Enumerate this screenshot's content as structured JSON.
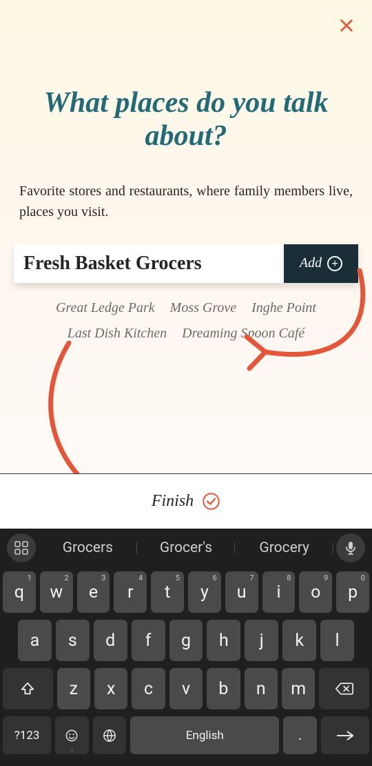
{
  "heading": "What places do you talk about?",
  "subheading": "Favorite stores and restaurants, where family members live, places you visit.",
  "input": {
    "value": "Fresh Basket Grocers"
  },
  "add_label": "Add",
  "suggestions": [
    "Great Ledge Park",
    "Moss Grove",
    "Inghe Point",
    "Last Dish Kitchen",
    "Dreaming Spoon Café"
  ],
  "finish_label": "Finish",
  "keyboard": {
    "suggestions": [
      "Grocers",
      "Grocer's",
      "Grocery"
    ],
    "row1": [
      {
        "k": "q",
        "h": "1"
      },
      {
        "k": "w",
        "h": "2"
      },
      {
        "k": "e",
        "h": "3"
      },
      {
        "k": "r",
        "h": "4"
      },
      {
        "k": "t",
        "h": "5"
      },
      {
        "k": "y",
        "h": "6"
      },
      {
        "k": "u",
        "h": "7"
      },
      {
        "k": "i",
        "h": "8"
      },
      {
        "k": "o",
        "h": "9"
      },
      {
        "k": "p",
        "h": "0"
      }
    ],
    "row2": [
      "a",
      "s",
      "d",
      "f",
      "g",
      "h",
      "j",
      "k",
      "l"
    ],
    "row3": [
      "z",
      "x",
      "c",
      "v",
      "b",
      "n",
      "m"
    ],
    "sym_label": "?123",
    "space_label": "English",
    "period": "."
  }
}
